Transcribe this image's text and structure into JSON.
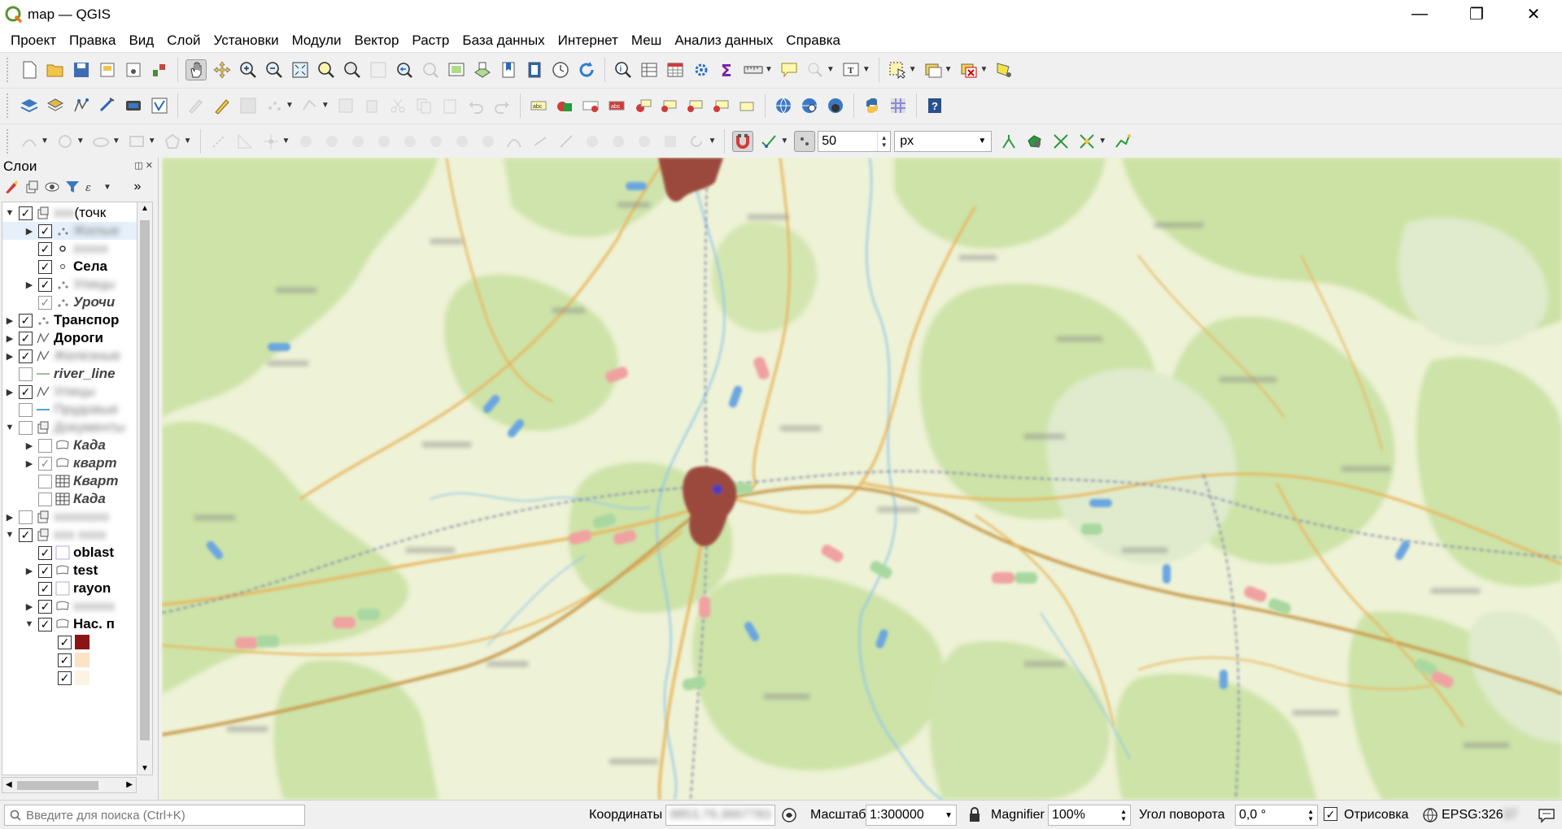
{
  "window": {
    "title": "map — QGIS",
    "minimize_icon": "—",
    "restore_icon": "❐",
    "close_icon": "✕"
  },
  "menu": [
    "Проект",
    "Правка",
    "Вид",
    "Слой",
    "Установки",
    "Модули",
    "Вектор",
    "Растр",
    "База данных",
    "Интернет",
    "Меш",
    "Анализ данных",
    "Справка"
  ],
  "digitizing": {
    "tolerance_value": "50",
    "tolerance_unit": "px"
  },
  "layers_panel": {
    "title": "Слои",
    "float_icon": "◫",
    "close_icon": "✕",
    "more_icon": "»",
    "rows": [
      {
        "expander": "▼",
        "checked": true,
        "icon": "group",
        "name": "ххх",
        "suffix": " (точк",
        "style": "",
        "blurred": true,
        "indent": 0
      },
      {
        "expander": "▶",
        "checked": true,
        "icon": "points",
        "name": "Жилые",
        "style": "",
        "blurred": true,
        "indent": 1,
        "selected": true
      },
      {
        "expander": "",
        "checked": true,
        "icon": "point",
        "name": "ххххх",
        "style": "",
        "blurred": true,
        "indent": 1
      },
      {
        "expander": "",
        "checked": true,
        "icon": "point-small",
        "name": "Села",
        "style": "b",
        "blurred": false,
        "indent": 1
      },
      {
        "expander": "▶",
        "checked": true,
        "icon": "points",
        "name": "Улицы",
        "style": "",
        "blurred": true,
        "indent": 1
      },
      {
        "expander": "",
        "checked": true,
        "icon": "points",
        "name": "Урочи",
        "style": "bi",
        "blurred": false,
        "indent": 1,
        "grey_check": true
      },
      {
        "expander": "▶",
        "checked": true,
        "icon": "points",
        "name": "Транспор",
        "style": "b",
        "blurred": false,
        "indent": 0
      },
      {
        "expander": "▶",
        "checked": true,
        "icon": "line",
        "name": "Дороги",
        "style": "b",
        "blurred": false,
        "indent": 0
      },
      {
        "expander": "▶",
        "checked": true,
        "icon": "line",
        "name": "Железные",
        "style": "",
        "blurred": true,
        "indent": 0
      },
      {
        "expander": "",
        "checked": false,
        "icon": "line-green",
        "name": "river_line",
        "style": "bi",
        "blurred": false,
        "indent": 0
      },
      {
        "expander": "▶",
        "checked": true,
        "icon": "line",
        "name": "Улицы",
        "style": "",
        "blurred": true,
        "indent": 0
      },
      {
        "expander": "",
        "checked": false,
        "icon": "line-blue",
        "name": "Прудовые",
        "style": "",
        "blurred": true,
        "indent": 0
      },
      {
        "expander": "▼",
        "checked": false,
        "icon": "group",
        "name": "Документы",
        "style": "",
        "blurred": true,
        "indent": 0
      },
      {
        "expander": "▶",
        "checked": false,
        "icon": "polygon",
        "name": "Када",
        "style": "bi",
        "blurred": false,
        "indent": 1
      },
      {
        "expander": "▶",
        "checked": true,
        "icon": "polygon",
        "name": "кварт",
        "style": "bi",
        "blurred": false,
        "indent": 1,
        "grey_check": true
      },
      {
        "expander": "",
        "checked": false,
        "icon": "table",
        "name": "Кварт",
        "style": "bi",
        "blurred": false,
        "indent": 1
      },
      {
        "expander": "",
        "checked": false,
        "icon": "table",
        "name": "Када",
        "style": "bi",
        "blurred": false,
        "indent": 1
      },
      {
        "expander": "▶",
        "checked": false,
        "icon": "group",
        "name": "хххххххх",
        "style": "",
        "blurred": true,
        "indent": 0
      },
      {
        "expander": "▼",
        "checked": true,
        "icon": "group",
        "name": "ххх хххх",
        "style": "",
        "blurred": true,
        "indent": 0
      },
      {
        "expander": "",
        "checked": true,
        "icon": "fill-empty",
        "name": "oblast",
        "style": "b",
        "blurred": false,
        "indent": 1
      },
      {
        "expander": "▶",
        "checked": true,
        "icon": "polygon",
        "name": "test",
        "style": "b",
        "blurred": false,
        "indent": 1
      },
      {
        "expander": "",
        "checked": true,
        "icon": "fill-empty",
        "name": "rayon",
        "style": "b",
        "blurred": false,
        "indent": 1
      },
      {
        "expander": "▶",
        "checked": true,
        "icon": "polygon",
        "name": "хххххх",
        "style": "",
        "blurred": true,
        "indent": 1
      },
      {
        "expander": "▼",
        "checked": true,
        "icon": "polygon",
        "name": "Нас. п",
        "style": "b",
        "blurred": false,
        "indent": 1
      },
      {
        "expander": "",
        "checked": true,
        "icon": "swatch-red",
        "name": "",
        "style": "",
        "blurred": false,
        "indent": 2
      },
      {
        "expander": "",
        "checked": true,
        "icon": "swatch-peach",
        "name": "",
        "style": "",
        "blurred": false,
        "indent": 2
      },
      {
        "expander": "",
        "checked": true,
        "icon": "swatch-light",
        "name": "",
        "style": "",
        "blurred": false,
        "indent": 2
      }
    ]
  },
  "status": {
    "search_placeholder": "Введите для поиска (Ctrl+K)",
    "coords_label": "Координаты",
    "coords_value": "9853,79,3667783",
    "scale_label": "Масштаб",
    "scale_value": "1:300000",
    "magnifier_label": "Magnifier",
    "magnifier_value": "100%",
    "rotation_label": "Угол поворота",
    "rotation_value": "0,0 °",
    "render_label": "Отрисовка",
    "render_checked": true,
    "crs_label": "EPSG:326",
    "crs_hidden": "37"
  },
  "colors": {
    "accent": "#2c7a2c",
    "town": "#9b4a3c",
    "map_base": "#eef2d6",
    "forest": "#c8e0a6"
  }
}
